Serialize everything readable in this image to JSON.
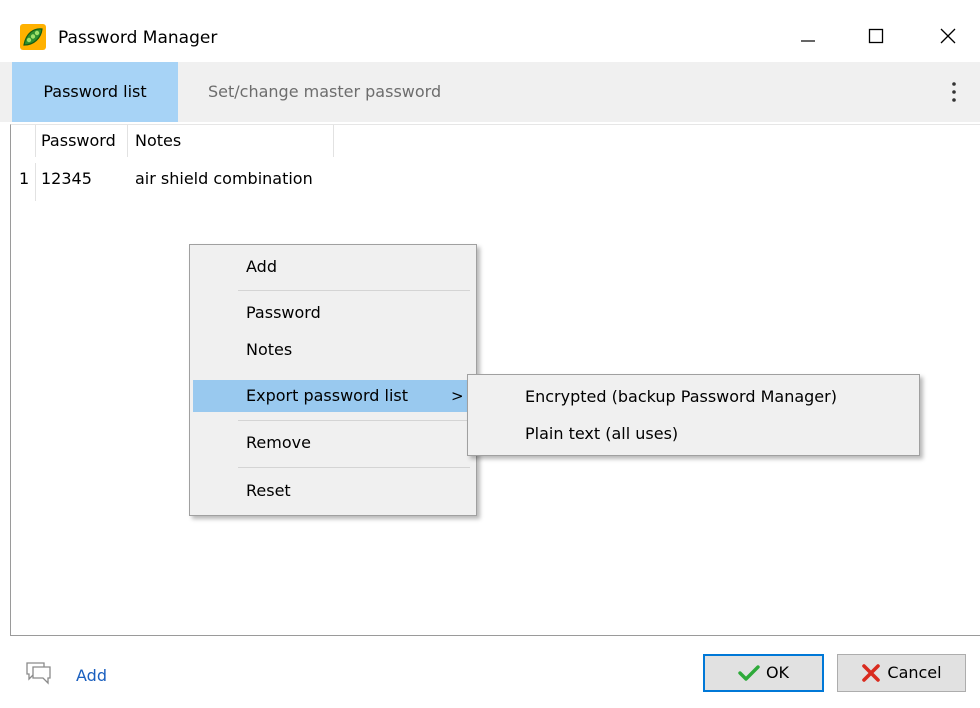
{
  "window": {
    "title": "Password Manager",
    "controls": {
      "minimize": "—",
      "maximize": "☐",
      "close": "✕"
    }
  },
  "tabs": [
    {
      "label": "Password list",
      "active": true
    },
    {
      "label": "Set/change master password",
      "active": false
    }
  ],
  "grid": {
    "columns": [
      "Password",
      "Notes"
    ],
    "rows": [
      {
        "index": "1",
        "password": "12345",
        "notes": "air shield combination"
      }
    ]
  },
  "context_menu": {
    "items": {
      "add": "Add",
      "password": "Password",
      "notes": "Notes",
      "export": "Export password list",
      "export_arrow": ">",
      "remove": "Remove",
      "reset": "Reset"
    },
    "submenu": {
      "encrypted": "Encrypted (backup Password Manager)",
      "plain_text": "Plain text (all uses)"
    }
  },
  "footer": {
    "add_label": "Add",
    "ok_label": "OK",
    "cancel_label": "Cancel"
  },
  "colors": {
    "accent_tab": "#a7d3f6",
    "menu_highlight": "#99c9ef",
    "link": "#1a5fbf",
    "ok_check": "#2eaa3a",
    "cancel_x": "#d92b1f"
  },
  "icons": {
    "app": "pea-pod-icon",
    "kebab": "more-vertical-icon",
    "add": "comment-icon",
    "ok": "checkmark-icon",
    "cancel": "x-icon"
  }
}
